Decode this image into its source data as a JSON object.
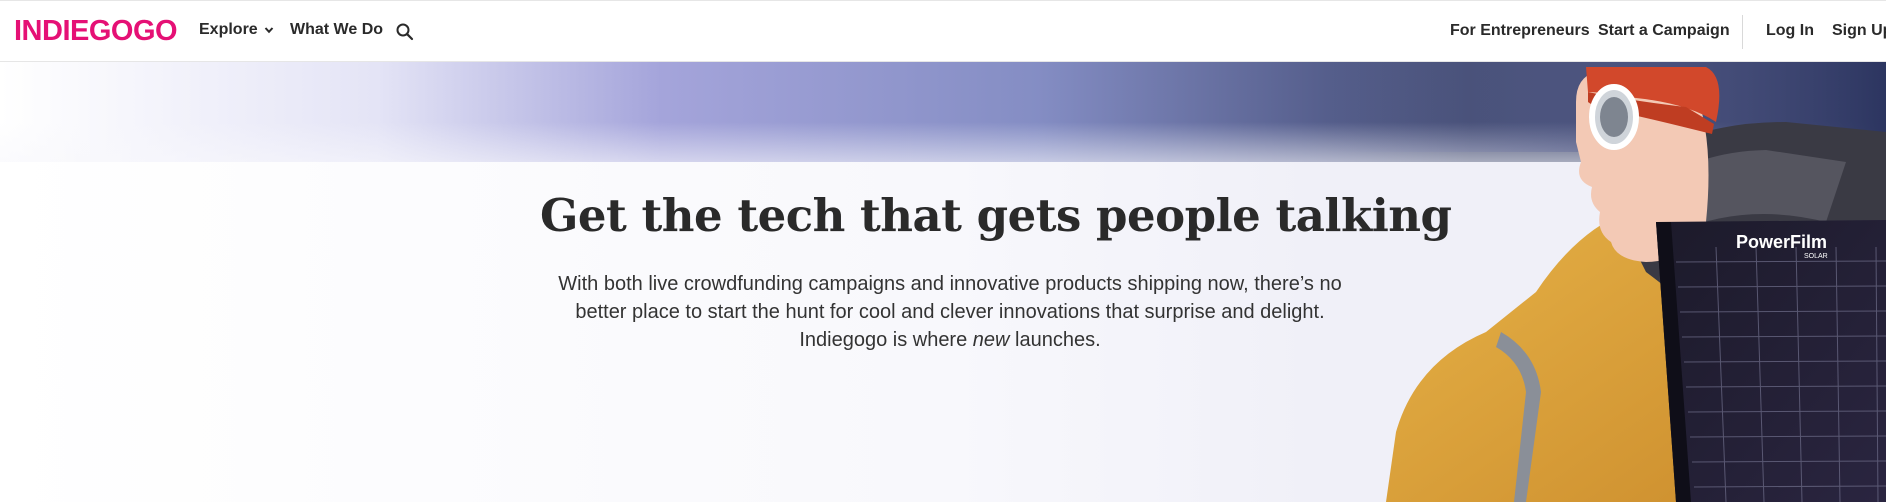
{
  "nav": {
    "logo": "INDIEGOGO",
    "explore_label": "Explore",
    "what_we_do_label": "What We Do",
    "search_icon": "search-icon",
    "for_entrepreneurs_label": "For Entrepreneurs",
    "start_campaign_label": "Start a Campaign",
    "login_label": "Log In",
    "signup_label": "Sign Up"
  },
  "hero": {
    "title": "Get the tech that gets people talking",
    "body_part1": "With both live crowdfunding campaigns and innovative products shipping now, there’s no better place to start the hunt for cool and clever innovations that surprise and delight. Indiegogo is where ",
    "body_emphasis": "new",
    "body_part2": " launches.",
    "image_brand_text": "PowerFilm",
    "image_brand_subtext": "SOLAR"
  },
  "colors": {
    "brand": "#e51075",
    "text": "#2a2a2a"
  }
}
